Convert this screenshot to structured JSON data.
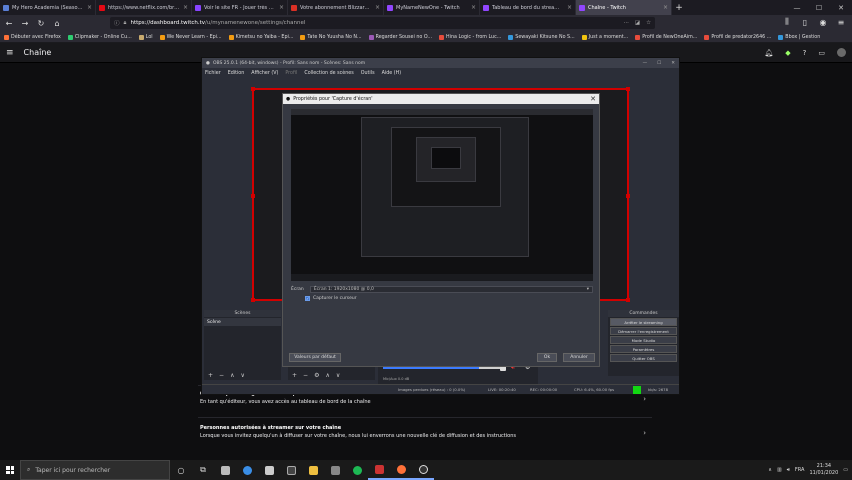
{
  "browser": {
    "tabs": [
      {
        "label": "My Hero Academia (Season 4)...",
        "color": "#5a7fd6",
        "active": false
      },
      {
        "label": "https://www.netflix.com/brow...",
        "color": "#e50914",
        "active": false
      },
      {
        "label": "Voir le site FR - Jouer très ques...",
        "color": "#8844ff",
        "active": false
      },
      {
        "label": "Votre abonnement Blizzard G...",
        "color": "#d93025",
        "active": false
      },
      {
        "label": "MyNameNewOne - Twitch",
        "color": "#9146ff",
        "active": false
      },
      {
        "label": "Tableau de bord du stream - Twitch",
        "color": "#9146ff",
        "active": false
      },
      {
        "label": "Chaîne - Twitch",
        "color": "#9146ff",
        "active": true
      }
    ],
    "url_host": "https://dashboard.twitch.tv",
    "url_path": "/u/mynamenewone/settings/channel",
    "bookmarks": [
      {
        "label": "Débuter avec Firefox",
        "color": "#ff7139"
      },
      {
        "label": "Clipmaker - Online Cu...",
        "color": "#2ecc71"
      },
      {
        "label": "Lol",
        "color": "#c8aa6e"
      },
      {
        "label": "We Never Learn - Epi...",
        "color": "#f39c12"
      },
      {
        "label": "Kimetsu no Yaiba - Epi...",
        "color": "#f39c12"
      },
      {
        "label": "Tate No Yuusha No N...",
        "color": "#f39c12"
      },
      {
        "label": "Regarder Sousei no O...",
        "color": "#9b59b6"
      },
      {
        "label": "Hina Logic - from Luc...",
        "color": "#e74c3c"
      },
      {
        "label": "Sewayaki Kitsune No S...",
        "color": "#3498db"
      },
      {
        "label": "Just a moment...",
        "color": "#f1c40f"
      },
      {
        "label": "Profil de NewOneAim...",
        "color": "#e74c3c"
      },
      {
        "label": "Profil de predator2646 ...",
        "color": "#e74c3c"
      },
      {
        "label": "Bbox | Gestion",
        "color": "#3498db"
      }
    ]
  },
  "twitch": {
    "title": "Chaîne",
    "rows": [
      {
        "title": "Chaînes que vous gérez en tant qu'éditeur",
        "desc": "En tant qu'éditeur, vous avez accès au tableau de bord de la chaîne"
      },
      {
        "title": "Personnes autorisées à streamer sur votre chaîne",
        "desc": "Lorsque vous invitez quelqu'un à diffuser sur votre chaîne, nous lui enverrons une nouvelle clé de diffusion et des instructions"
      }
    ]
  },
  "obs": {
    "title": "OBS 25.0.1 (64-bit, windows) - Profil: Sans nom - Scènes: Sans nom",
    "menu": [
      "Fichier",
      "Edition",
      "Afficher (V)",
      "Profil",
      "Collection de scènes",
      "Outils",
      "Aide (H)"
    ],
    "scenes_header": "Scènes",
    "scene_item": "Scène",
    "controls_header": "Commandes",
    "controls": [
      "Arrêter le streaming",
      "Démarrer l'enregistrement",
      "Mode Studio",
      "Paramètres",
      "Quitter OBS"
    ],
    "mixer_label": "Mic/Aux 0.0 dB",
    "status": {
      "dropped": "Images perdues (réseau) : 0 (0.0%)",
      "live": "LIVE: 00:20:40",
      "rec": "REC: 00:00:00",
      "cpu": "CPU: 6.4%, 60.00 fps",
      "kbps": "kb/s: 2678"
    }
  },
  "dialog": {
    "title": "Propriétés pour 'Capture d'écran'",
    "ecran_label": "Écran",
    "ecran_value": "Écran 1: 1920x1080 @ 0,0",
    "capture_label": "Capturer le curseur",
    "defaults_btn": "Valeurs par défaut",
    "ok_btn": "Ok",
    "cancel_btn": "Annuler"
  },
  "taskbar": {
    "search_placeholder": "Taper ici pour rechercher",
    "lang": "FRA",
    "time": "21:34",
    "date": "11/01/2020"
  }
}
